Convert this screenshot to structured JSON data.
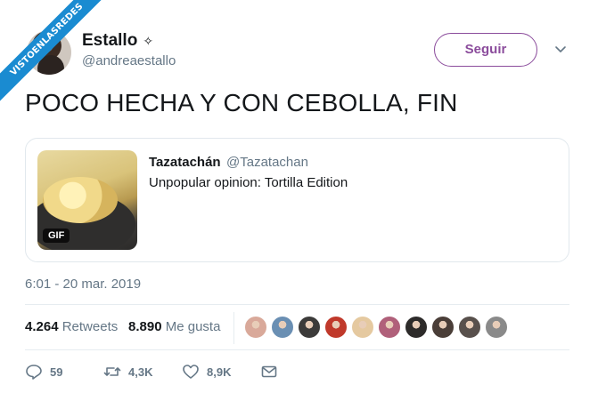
{
  "watermark": {
    "text": "VISTOENLASREDES"
  },
  "author": {
    "display_name": "Estallo",
    "badge_glyph": "✧",
    "handle": "@andreaestallo",
    "avatar_icon": "avatar"
  },
  "follow_button": {
    "label": "Seguir",
    "color": "#8b4c9c"
  },
  "tweet": {
    "text": "POCO HECHA Y CON CEBOLLA, FIN",
    "timestamp": "6:01 - 20 mar. 2019"
  },
  "quoted_tweet": {
    "name": "Tazatachán",
    "handle": "@Tazatachan",
    "text": "Unpopular opinion: Tortilla Edition",
    "media_badge": "GIF"
  },
  "stats": {
    "retweets_count": "4.264",
    "retweets_label": "Retweets",
    "likes_count": "8.890",
    "likes_label": "Me gusta",
    "liker_avatar_colors": [
      "#d9a99a",
      "#6a8fb3",
      "#3c3b3a",
      "#c0392b",
      "#e5c9a0",
      "#b0607a",
      "#2d2b2a",
      "#4a3e38",
      "#58504c",
      "#8a8a8a"
    ]
  },
  "actions": {
    "reply_count": "59",
    "retweet_count": "4,3K",
    "like_count": "8,9K",
    "icons": [
      "reply-icon",
      "retweet-icon",
      "heart-icon",
      "mail-icon"
    ]
  }
}
